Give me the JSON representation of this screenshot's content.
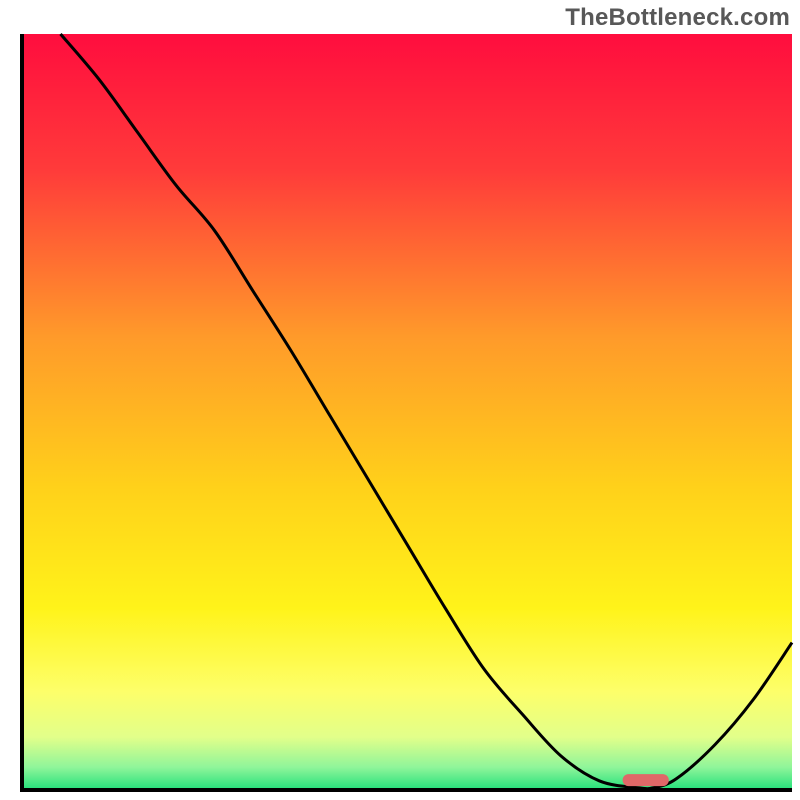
{
  "attribution": "TheBottleneck.com",
  "chart_data": {
    "type": "line",
    "title": "",
    "xlabel": "",
    "ylabel": "",
    "xlim": [
      0,
      100
    ],
    "ylim": [
      0,
      100
    ],
    "x": [
      5,
      10,
      15,
      20,
      25,
      30,
      35,
      40,
      45,
      50,
      55,
      60,
      65,
      70,
      75,
      80,
      82,
      85,
      90,
      95,
      100
    ],
    "values": [
      100,
      94,
      87,
      80,
      74,
      66,
      58,
      49.5,
      41,
      32.5,
      24,
      16,
      10,
      4.5,
      1.2,
      0.3,
      0.3,
      1.5,
      6,
      12,
      19.5
    ],
    "marker": {
      "x_start": 78,
      "x_end": 84,
      "y": 1.3
    },
    "background_gradient_stops": [
      {
        "offset": 0,
        "color": "#ff0d3e"
      },
      {
        "offset": 18,
        "color": "#ff3b3a"
      },
      {
        "offset": 40,
        "color": "#ff9a2a"
      },
      {
        "offset": 60,
        "color": "#ffd11a"
      },
      {
        "offset": 76,
        "color": "#fff31a"
      },
      {
        "offset": 87,
        "color": "#fdff6a"
      },
      {
        "offset": 93,
        "color": "#e2ff8a"
      },
      {
        "offset": 97,
        "color": "#8ff59a"
      },
      {
        "offset": 100,
        "color": "#22e07a"
      }
    ],
    "marker_color": "#e06868",
    "line_color": "#000000",
    "frame_color": "#000000"
  }
}
